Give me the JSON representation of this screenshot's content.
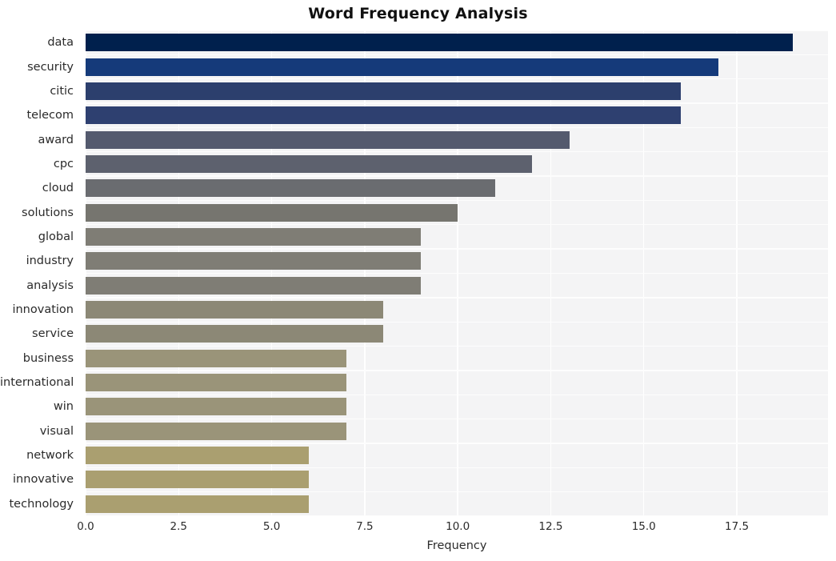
{
  "chart_data": {
    "type": "bar",
    "orientation": "horizontal",
    "title": "Word Frequency Analysis",
    "xlabel": "Frequency",
    "ylabel": "",
    "categories": [
      "data",
      "security",
      "citic",
      "telecom",
      "award",
      "cpc",
      "cloud",
      "solutions",
      "global",
      "industry",
      "analysis",
      "innovation",
      "service",
      "business",
      "international",
      "win",
      "visual",
      "network",
      "innovative",
      "technology"
    ],
    "values": [
      19,
      17,
      16,
      16,
      13,
      12,
      11,
      10,
      9,
      9,
      9,
      8,
      8,
      7,
      7,
      7,
      7,
      6,
      6,
      6
    ],
    "xlim": [
      0,
      19.95
    ],
    "xticks": [
      0.0,
      2.5,
      5.0,
      7.5,
      10.0,
      12.5,
      15.0,
      17.5
    ],
    "xtick_labels": [
      "0.0",
      "2.5",
      "5.0",
      "7.5",
      "10.0",
      "12.5",
      "15.0",
      "17.5"
    ],
    "grid": true,
    "grid_color": "#ffffff",
    "legend": "none",
    "plot_background": "#f4f4f5",
    "figure_background": "#ffffff",
    "bar_colors": [
      "#00204d",
      "#153a7a",
      "#2c3f6d",
      "#2e4070",
      "#545a6e",
      "#5d616e",
      "#6a6c70",
      "#76756f",
      "#7f7d75",
      "#7f7d75",
      "#7f7d75",
      "#8c8876",
      "#8c8876",
      "#9a9479",
      "#9a9479",
      "#9a9479",
      "#9a9479",
      "#aa9f70",
      "#aa9f70",
      "#aa9f70"
    ]
  }
}
